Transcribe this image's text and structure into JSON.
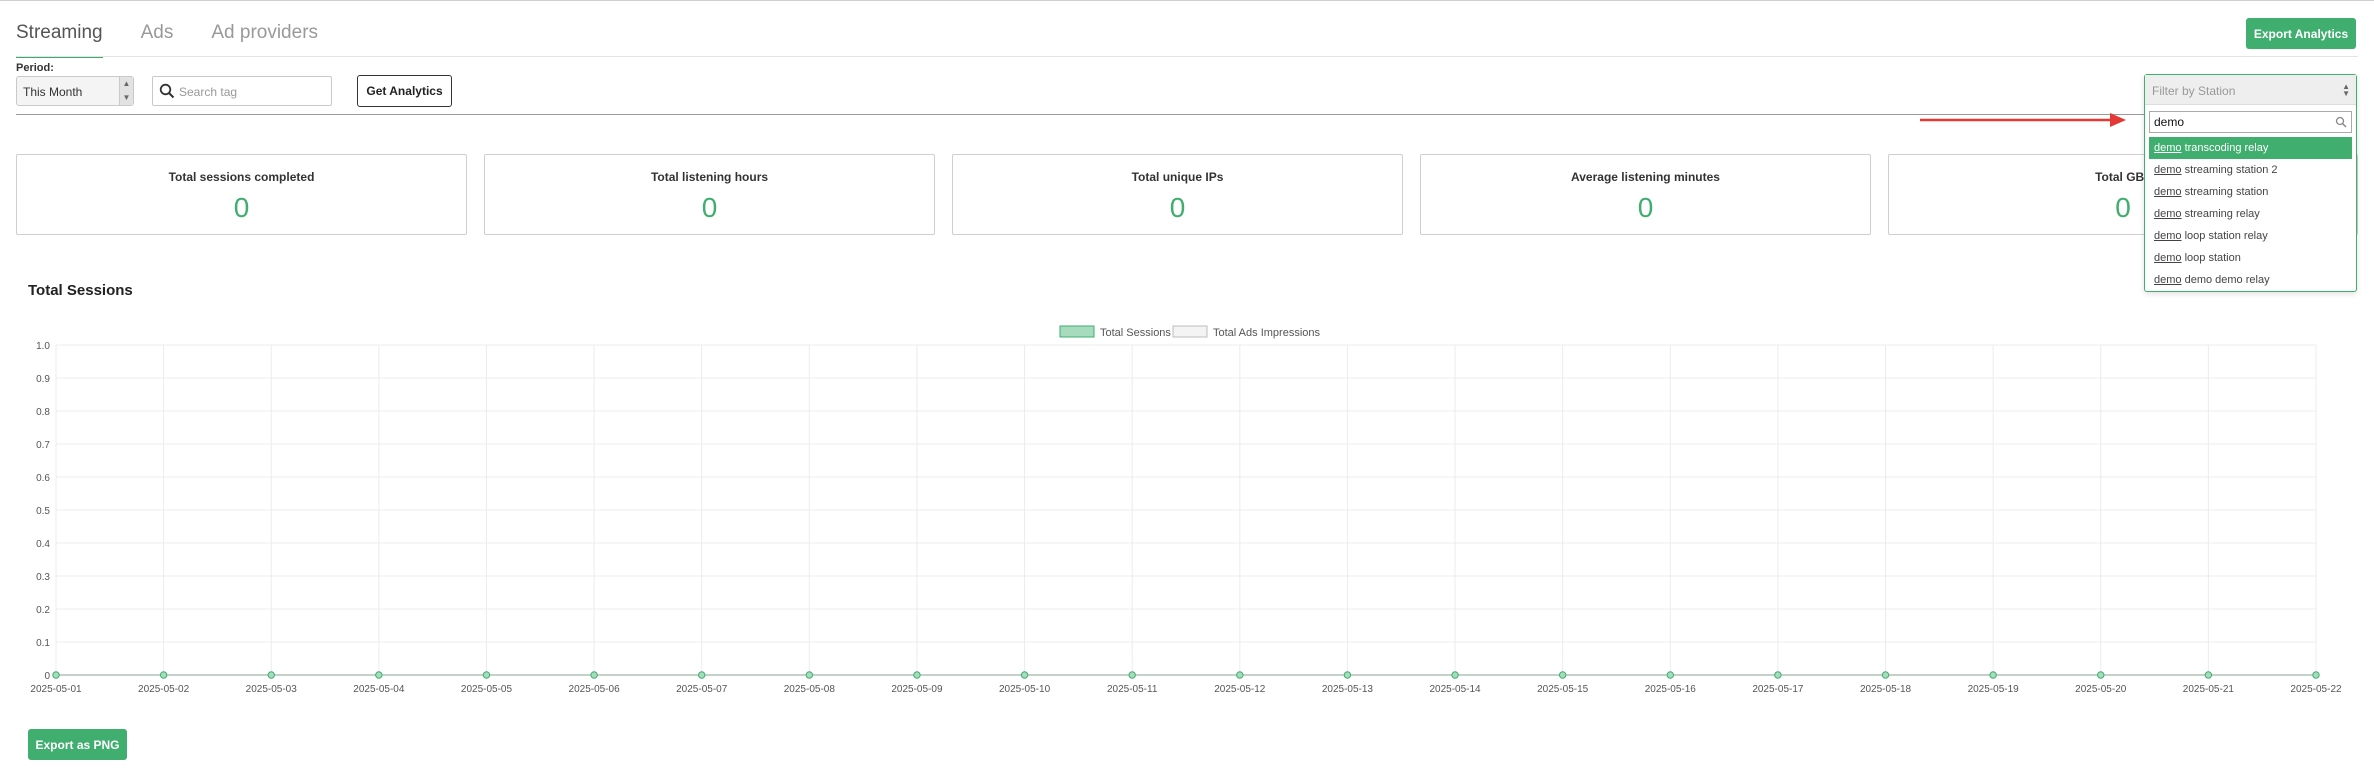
{
  "tabs": [
    {
      "label": "Streaming",
      "active": true
    },
    {
      "label": "Ads",
      "active": false
    },
    {
      "label": "Ad providers",
      "active": false
    }
  ],
  "header": {
    "export_label": "Export Analytics"
  },
  "filters": {
    "period_label": "Period:",
    "period_value": "This Month",
    "search_placeholder": "Search tag",
    "get_analytics_label": "Get Analytics"
  },
  "station_filter": {
    "placeholder": "Filter by Station",
    "search_value": "demo",
    "options": [
      {
        "match": "demo",
        "rest": " transcoding relay",
        "selected": true
      },
      {
        "match": "demo",
        "rest": " streaming station 2",
        "selected": false
      },
      {
        "match": "demo",
        "rest": " streaming station",
        "selected": false
      },
      {
        "match": "demo",
        "rest": " streaming relay",
        "selected": false
      },
      {
        "match": "demo",
        "rest": " loop station relay",
        "selected": false
      },
      {
        "match": "demo",
        "rest": " loop station",
        "selected": false
      },
      {
        "match": "demo",
        "rest": " demo demo relay",
        "selected": false
      }
    ]
  },
  "stats": [
    {
      "title": "Total sessions completed",
      "value": "0"
    },
    {
      "title": "Total listening hours",
      "value": "0"
    },
    {
      "title": "Total unique IPs",
      "value": "0"
    },
    {
      "title": "Average listening minutes",
      "value": "0"
    },
    {
      "title": "Total GBs",
      "value": "0"
    }
  ],
  "section_title": "Total Sessions",
  "export_png_label": "Export as PNG",
  "colors": {
    "accent": "#3fae6f",
    "arrow": "#e53935"
  },
  "chart_data": {
    "type": "line",
    "title": "",
    "xlabel": "",
    "ylabel": "",
    "ylim": [
      0,
      1.0
    ],
    "yticks": [
      "0",
      "0.1",
      "0.2",
      "0.3",
      "0.4",
      "0.5",
      "0.6",
      "0.7",
      "0.8",
      "0.9",
      "1.0"
    ],
    "legend_position": "top-center",
    "grid": true,
    "x": [
      "2025-05-01",
      "2025-05-02",
      "2025-05-03",
      "2025-05-04",
      "2025-05-05",
      "2025-05-06",
      "2025-05-07",
      "2025-05-08",
      "2025-05-09",
      "2025-05-10",
      "2025-05-11",
      "2025-05-12",
      "2025-05-13",
      "2025-05-14",
      "2025-05-15",
      "2025-05-16",
      "2025-05-17",
      "2025-05-18",
      "2025-05-19",
      "2025-05-20",
      "2025-05-21",
      "2025-05-22"
    ],
    "series": [
      {
        "name": "Total Sessions",
        "color": "#3fae6f",
        "values": [
          0,
          0,
          0,
          0,
          0,
          0,
          0,
          0,
          0,
          0,
          0,
          0,
          0,
          0,
          0,
          0,
          0,
          0,
          0,
          0,
          0,
          0
        ]
      },
      {
        "name": "Total Ads Impressions",
        "color": "#cfcfcf",
        "values": [
          0,
          0,
          0,
          0,
          0,
          0,
          0,
          0,
          0,
          0,
          0,
          0,
          0,
          0,
          0,
          0,
          0,
          0,
          0,
          0,
          0,
          0
        ]
      }
    ]
  }
}
